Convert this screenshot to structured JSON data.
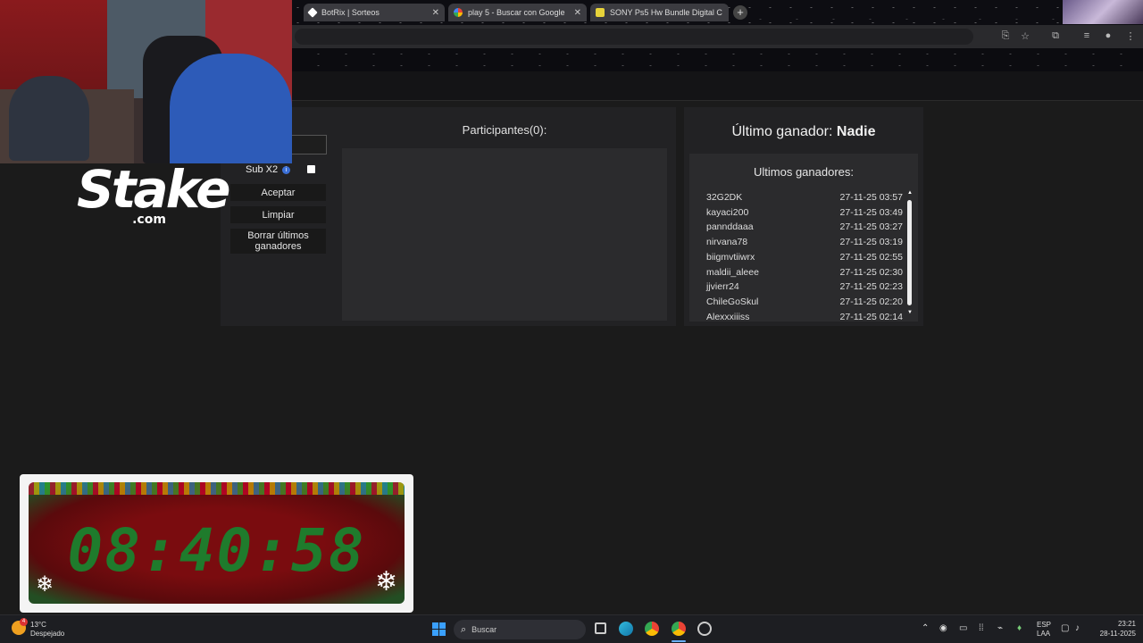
{
  "browser": {
    "tabs": [
      {
        "title": "BotRix | Sorteos"
      },
      {
        "title": "play 5 - Buscar con Google"
      },
      {
        "title": "SONY Ps5 Hw Bundle Digital C"
      }
    ],
    "new_tab": "+"
  },
  "stake_logo": {
    "main": "Stake",
    "sub": ".com"
  },
  "controls": {
    "sub_label": "Sub X2",
    "info_icon": "i",
    "accept": "Aceptar",
    "clear": "Limpiar",
    "clear_winners": "Borrar últimos ganadores"
  },
  "participants": {
    "title": "Participantes(0):"
  },
  "winner": {
    "label": "Último ganador:",
    "name": "Nadie"
  },
  "recent": {
    "title": "Ultimos ganadores:",
    "rows": [
      {
        "user": "32G2DK",
        "time": "27-11-25 03:57"
      },
      {
        "user": "kayaci200",
        "time": "27-11-25 03:49"
      },
      {
        "user": "pannddaaa",
        "time": "27-11-25 03:27"
      },
      {
        "user": "nirvana78",
        "time": "27-11-25 03:19"
      },
      {
        "user": "biigmvtiiwrx",
        "time": "27-11-25 02:55"
      },
      {
        "user": "maldii_aleee",
        "time": "27-11-25 02:30"
      },
      {
        "user": "jjvierr24",
        "time": "27-11-25 02:23"
      },
      {
        "user": "ChileGoSkul",
        "time": "27-11-25 02:20"
      },
      {
        "user": "Alexxxiiiss",
        "time": "27-11-25 02:14"
      }
    ]
  },
  "timer": {
    "value": "08:40:58"
  },
  "taskbar": {
    "weather_temp": "13°C",
    "weather_desc": "Despejado",
    "weather_badge": "4",
    "search_placeholder": "Buscar",
    "lang_top": "ESP",
    "lang_bottom": "LAA",
    "clock_time": "23:21",
    "clock_date": "28-11-2025"
  },
  "colors": {
    "timer_green": "#1f7b2c",
    "accent": "#3b6fd6"
  }
}
